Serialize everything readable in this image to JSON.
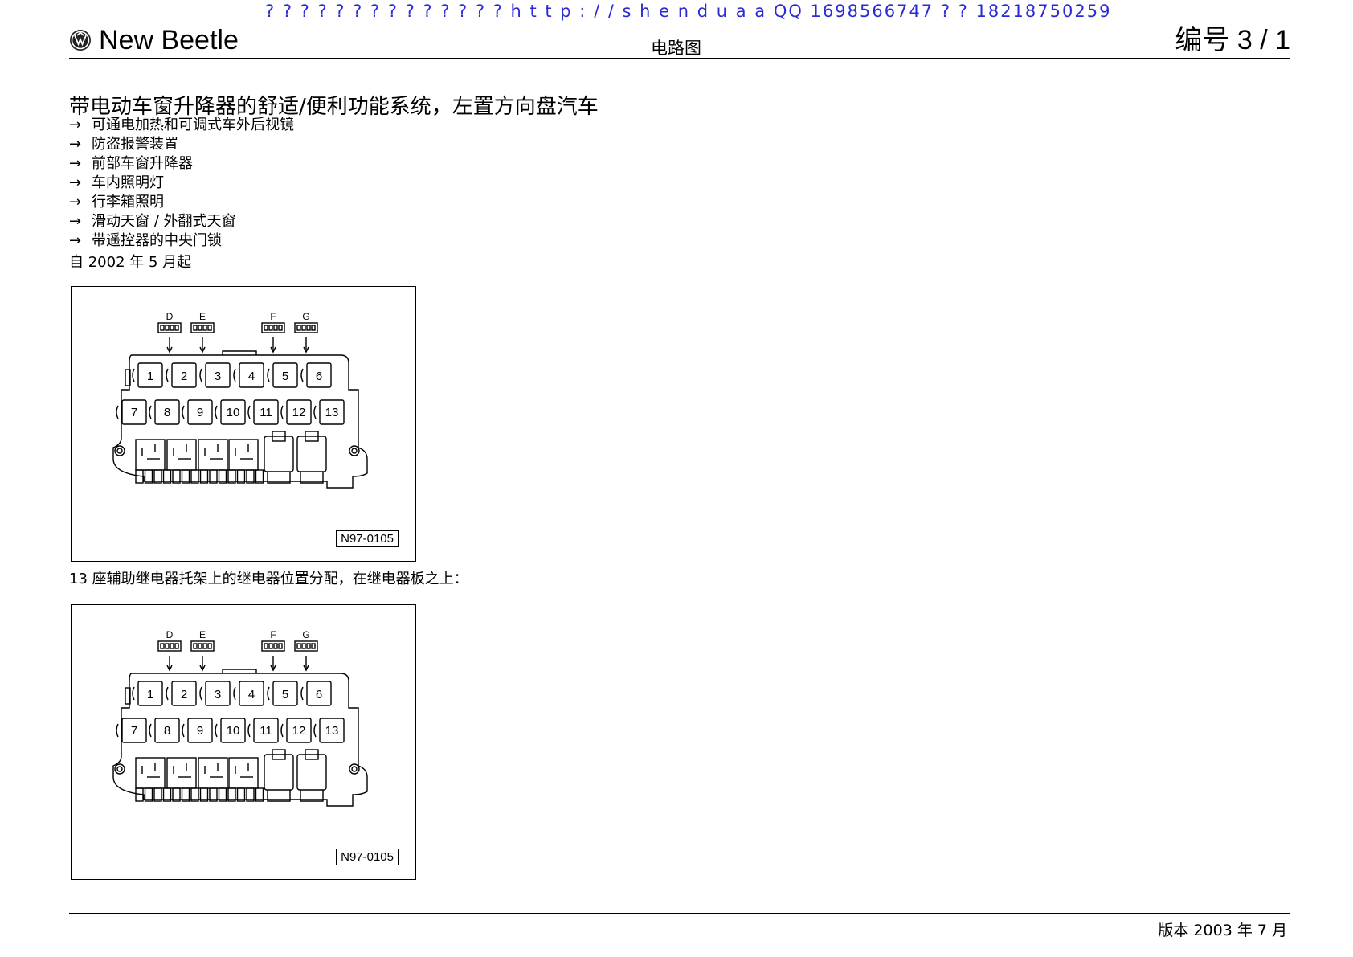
{
  "watermark": "? ? ? ? ? ? ? ? ? ? ? ? ? ?   h t t p : / / s h e n d u a  a  QQ   1698566747  ? ?  18218750259",
  "header": {
    "logo_icon": "vw-logo-icon",
    "brand": "New Beetle",
    "doc_type": "电路图",
    "number": "编号  3 / 1"
  },
  "title": "带电动车窗升降器的舒适/便利功能系统，左置方向盘汽车",
  "features": [
    "可通电加热和可调式车外后视镜",
    "防盗报警装置",
    "前部车窗升降器",
    "车内照明灯",
    "行李箱照明",
    "滑动天窗 / 外翻式天窗",
    "带遥控器的中央门锁"
  ],
  "arrow": "→",
  "since": "自 2002 年 5 月起",
  "figures": [
    {
      "code": "N97-0105"
    },
    {
      "code": "N97-0105"
    }
  ],
  "diagram": {
    "connector_labels": [
      "D",
      "E",
      "F",
      "G"
    ],
    "slots_row1": [
      "1",
      "2",
      "3",
      "4",
      "5",
      "6"
    ],
    "slots_row2": [
      "7",
      "8",
      "9",
      "10",
      "11",
      "12",
      "13"
    ]
  },
  "caption": "13 座辅助继电器托架上的继电器位置分配，在继电器板之上：",
  "footer": {
    "edition": "版本 2003 年 7 月"
  }
}
